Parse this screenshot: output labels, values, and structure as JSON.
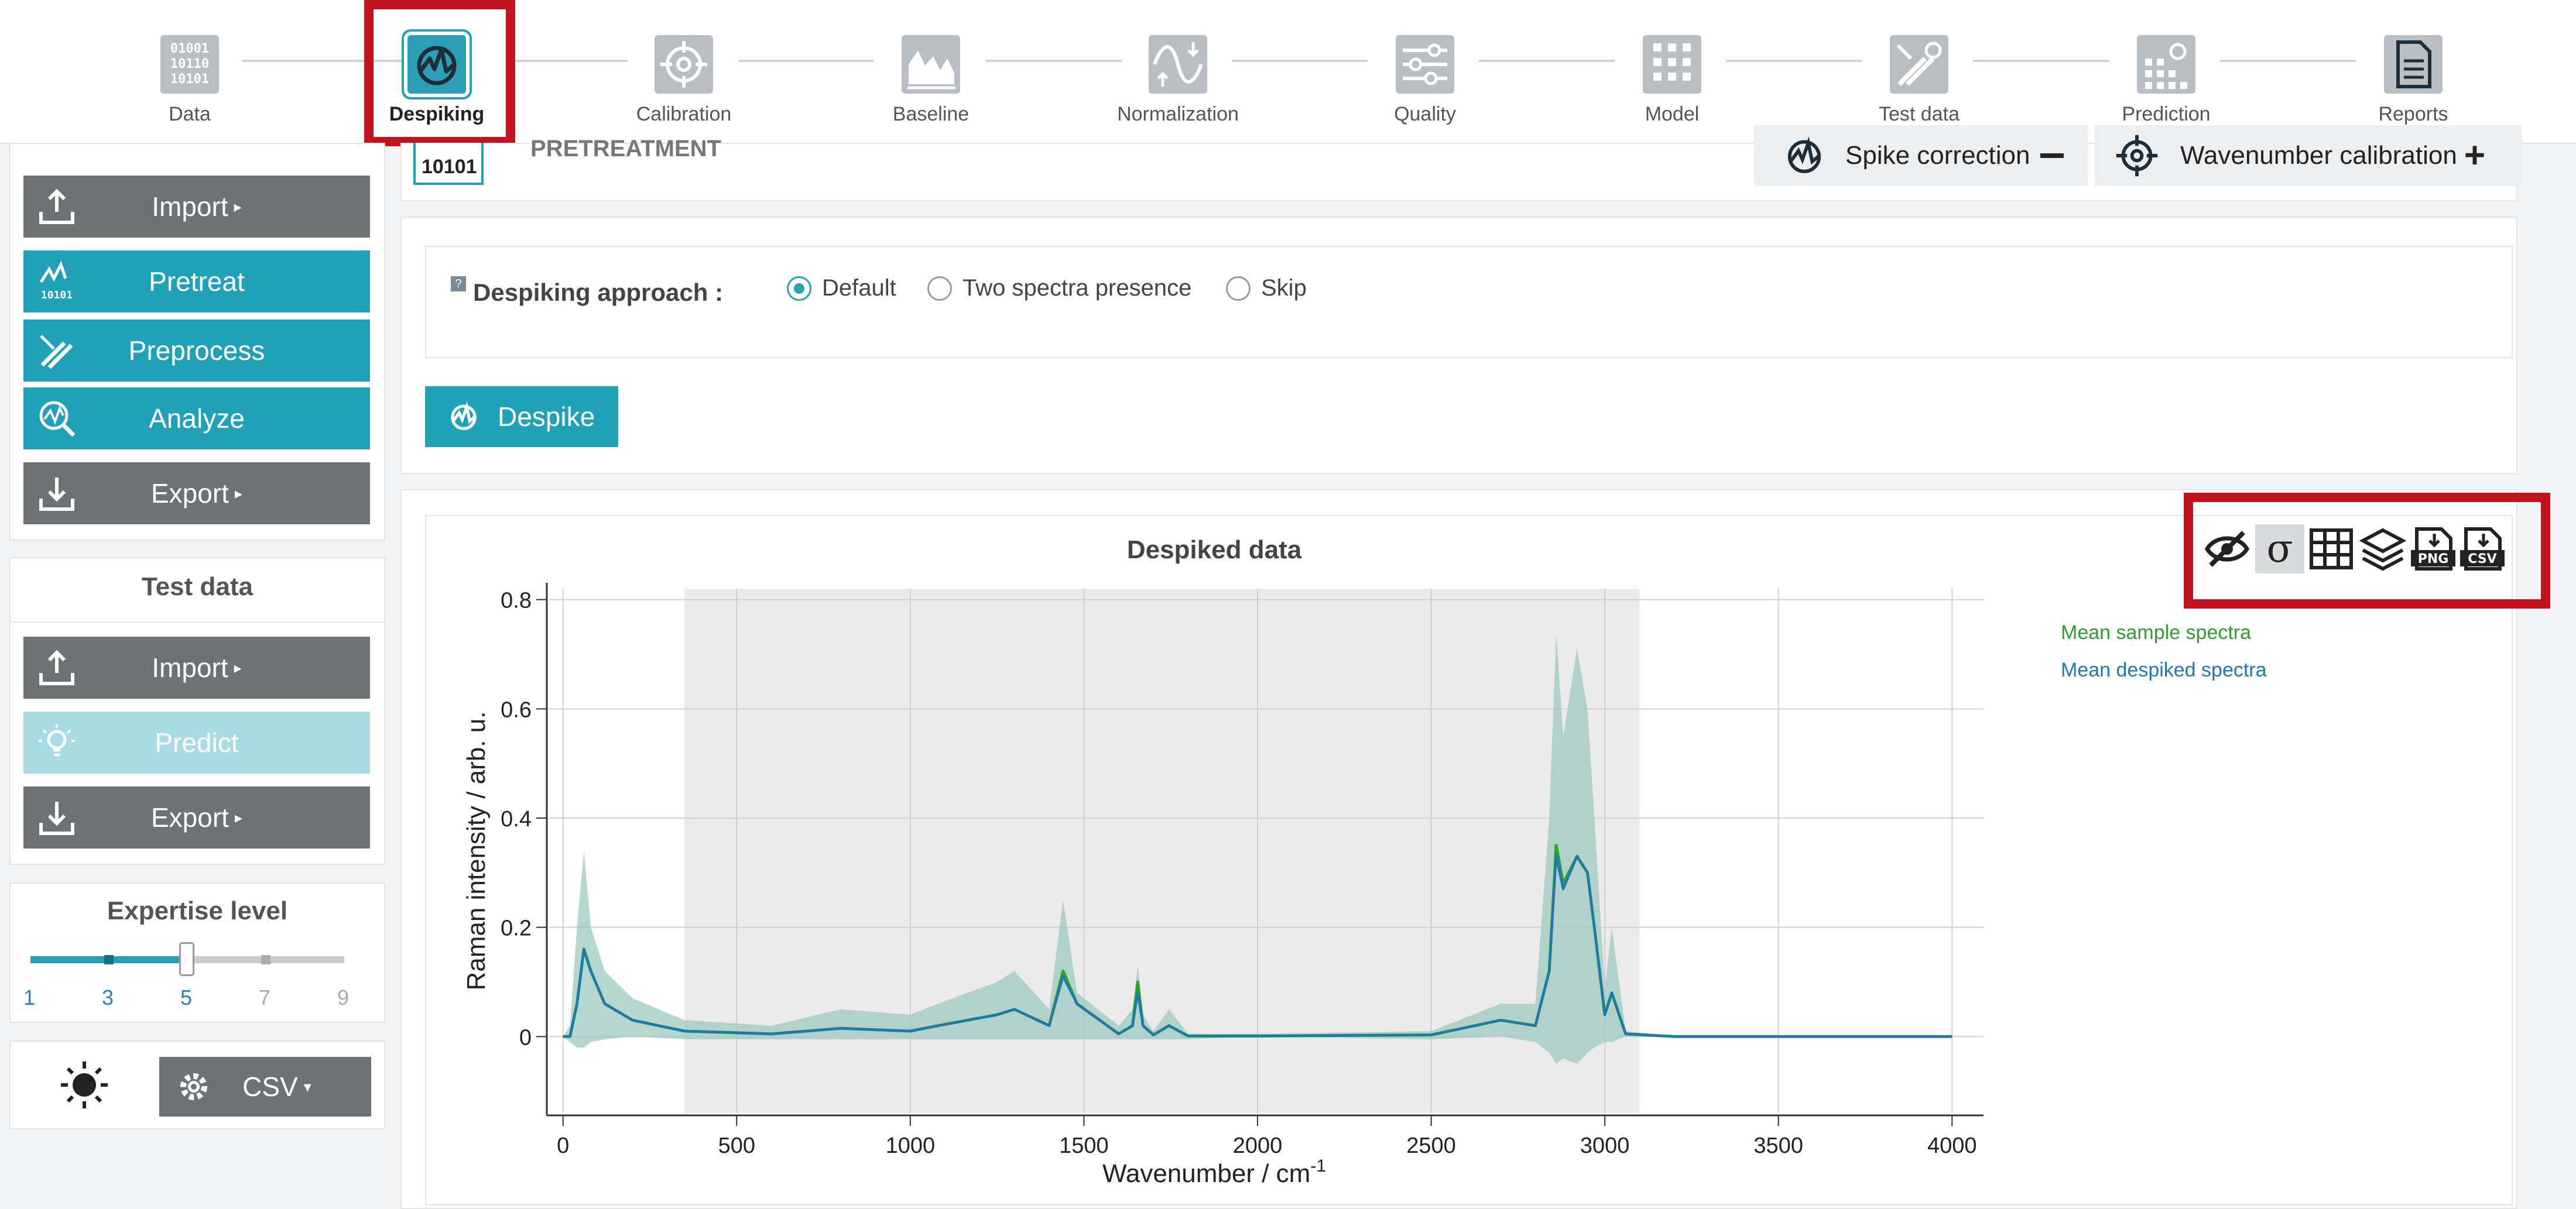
{
  "workflow": {
    "steps": [
      {
        "label": "Data",
        "icon": "binary-data-icon",
        "active": false
      },
      {
        "label": "Despiking",
        "icon": "despiking-icon",
        "active": true
      },
      {
        "label": "Calibration",
        "icon": "target-icon",
        "active": false
      },
      {
        "label": "Baseline",
        "icon": "baseline-chart-icon",
        "active": false
      },
      {
        "label": "Normalization",
        "icon": "normalization-icon",
        "active": false
      },
      {
        "label": "Quality",
        "icon": "sliders-icon",
        "active": false
      },
      {
        "label": "Model",
        "icon": "model-grid-icon",
        "active": false
      },
      {
        "label": "Test data",
        "icon": "test-tools-icon",
        "active": false
      },
      {
        "label": "Prediction",
        "icon": "prediction-icon",
        "active": false
      },
      {
        "label": "Reports",
        "icon": "report-document-icon",
        "active": false
      }
    ]
  },
  "sidebar": {
    "main_buttons": {
      "import": "Import",
      "pretreat": "Pretreat",
      "preprocess": "Preprocess",
      "analyze": "Analyze",
      "export": "Export",
      "pretreat_icon_text": "10101"
    },
    "test_data": {
      "title": "Test data",
      "import": "Import",
      "predict": "Predict",
      "export": "Export"
    },
    "expertise": {
      "title": "Expertise level",
      "value": 5,
      "ticks": [
        "1",
        "3",
        "5",
        "7",
        "9"
      ]
    },
    "bottom": {
      "format": "CSV"
    }
  },
  "header": {
    "section": "PRETREATMENT",
    "section_icon_text": "10101",
    "spike_correction": "Spike correction",
    "wavenumber_calibration": "Wavenumber calibration"
  },
  "despiking": {
    "question_mark": "?",
    "label": "Despiking approach :",
    "options": [
      "Default",
      "Two spectra presence",
      "Skip"
    ],
    "selected": "Default",
    "button": "Despike"
  },
  "toolbar": {
    "png": "PNG",
    "csv": "CSV"
  },
  "colors": {
    "teal": "#1fa2b8",
    "gray_button": "#6f7275",
    "sample_series": "#2ca02c",
    "despiked_series": "#1f77b4",
    "band": "#9ec9c0",
    "highlight_red": "#c0141f"
  },
  "chart_data": {
    "type": "line",
    "title": "Despiked data",
    "xlabel": "Wavenumber / cm",
    "xlabel_sup": "-1",
    "ylabel": "Raman intensity / arb. u.",
    "xlim": [
      -40,
      4040
    ],
    "ylim": [
      -0.14,
      0.82
    ],
    "xticks": [
      0,
      500,
      1000,
      1500,
      2000,
      2500,
      3000,
      3500,
      4000
    ],
    "yticks": [
      0,
      0.2,
      0.4,
      0.6,
      0.8
    ],
    "grid": true,
    "legend_position": "top-right",
    "shaded_region": [
      350,
      3100
    ],
    "series": [
      {
        "name": "Mean sample spectra",
        "color": "#2ca02c",
        "x": [
          0,
          20,
          40,
          60,
          80,
          120,
          200,
          350,
          600,
          800,
          1000,
          1080,
          1250,
          1300,
          1400,
          1440,
          1480,
          1600,
          1640,
          1655,
          1670,
          1700,
          1745,
          1800,
          2000,
          2500,
          2700,
          2800,
          2840,
          2860,
          2880,
          2920,
          2950,
          2970,
          3000,
          3020,
          3060,
          3200,
          4000
        ],
        "y": [
          0.0,
          0.0,
          0.06,
          0.16,
          0.12,
          0.06,
          0.03,
          0.01,
          0.005,
          0.015,
          0.01,
          0.02,
          0.04,
          0.05,
          0.02,
          0.12,
          0.06,
          0.005,
          0.02,
          0.1,
          0.02,
          0.003,
          0.02,
          0.001,
          0.001,
          0.003,
          0.03,
          0.02,
          0.12,
          0.35,
          0.28,
          0.33,
          0.3,
          0.2,
          0.04,
          0.08,
          0.005,
          0.0,
          0.0
        ]
      },
      {
        "name": "Mean despiked spectra",
        "color": "#1f77b4",
        "x": [
          0,
          20,
          40,
          60,
          80,
          120,
          200,
          350,
          600,
          800,
          1000,
          1080,
          1250,
          1300,
          1400,
          1440,
          1480,
          1600,
          1640,
          1655,
          1670,
          1700,
          1745,
          1800,
          2000,
          2500,
          2700,
          2800,
          2840,
          2860,
          2880,
          2920,
          2950,
          2970,
          3000,
          3020,
          3060,
          3200,
          4000
        ],
        "y": [
          0.0,
          0.0,
          0.06,
          0.16,
          0.12,
          0.06,
          0.03,
          0.01,
          0.005,
          0.015,
          0.01,
          0.02,
          0.04,
          0.05,
          0.02,
          0.11,
          0.06,
          0.005,
          0.02,
          0.08,
          0.02,
          0.003,
          0.02,
          0.001,
          0.001,
          0.003,
          0.03,
          0.02,
          0.12,
          0.33,
          0.27,
          0.33,
          0.3,
          0.2,
          0.04,
          0.08,
          0.005,
          0.0,
          0.0
        ]
      }
    ],
    "band": {
      "x": [
        0,
        20,
        40,
        60,
        80,
        120,
        200,
        350,
        600,
        800,
        1000,
        1080,
        1250,
        1300,
        1400,
        1440,
        1480,
        1600,
        1640,
        1655,
        1670,
        1700,
        1745,
        1800,
        2000,
        2500,
        2700,
        2800,
        2840,
        2860,
        2880,
        2920,
        2950,
        2970,
        3000,
        3020,
        3060,
        3200,
        4000
      ],
      "upper": [
        0.0,
        0.02,
        0.2,
        0.34,
        0.2,
        0.12,
        0.07,
        0.03,
        0.02,
        0.05,
        0.04,
        0.06,
        0.1,
        0.12,
        0.05,
        0.25,
        0.08,
        0.02,
        0.05,
        0.13,
        0.04,
        0.01,
        0.05,
        0.005,
        0.005,
        0.01,
        0.06,
        0.06,
        0.4,
        0.74,
        0.55,
        0.71,
        0.6,
        0.4,
        0.09,
        0.2,
        0.01,
        0.0,
        0.0
      ],
      "lower": [
        0.0,
        -0.01,
        -0.02,
        -0.02,
        -0.01,
        -0.005,
        0.0,
        -0.005,
        -0.005,
        -0.005,
        -0.005,
        -0.005,
        -0.005,
        -0.005,
        -0.005,
        -0.005,
        -0.005,
        -0.005,
        -0.005,
        -0.005,
        -0.005,
        -0.005,
        -0.005,
        -0.005,
        0.0,
        -0.005,
        0.0,
        -0.01,
        -0.03,
        -0.05,
        -0.04,
        -0.05,
        -0.03,
        -0.02,
        -0.01,
        -0.01,
        0.0,
        0.0,
        0.0
      ]
    }
  }
}
